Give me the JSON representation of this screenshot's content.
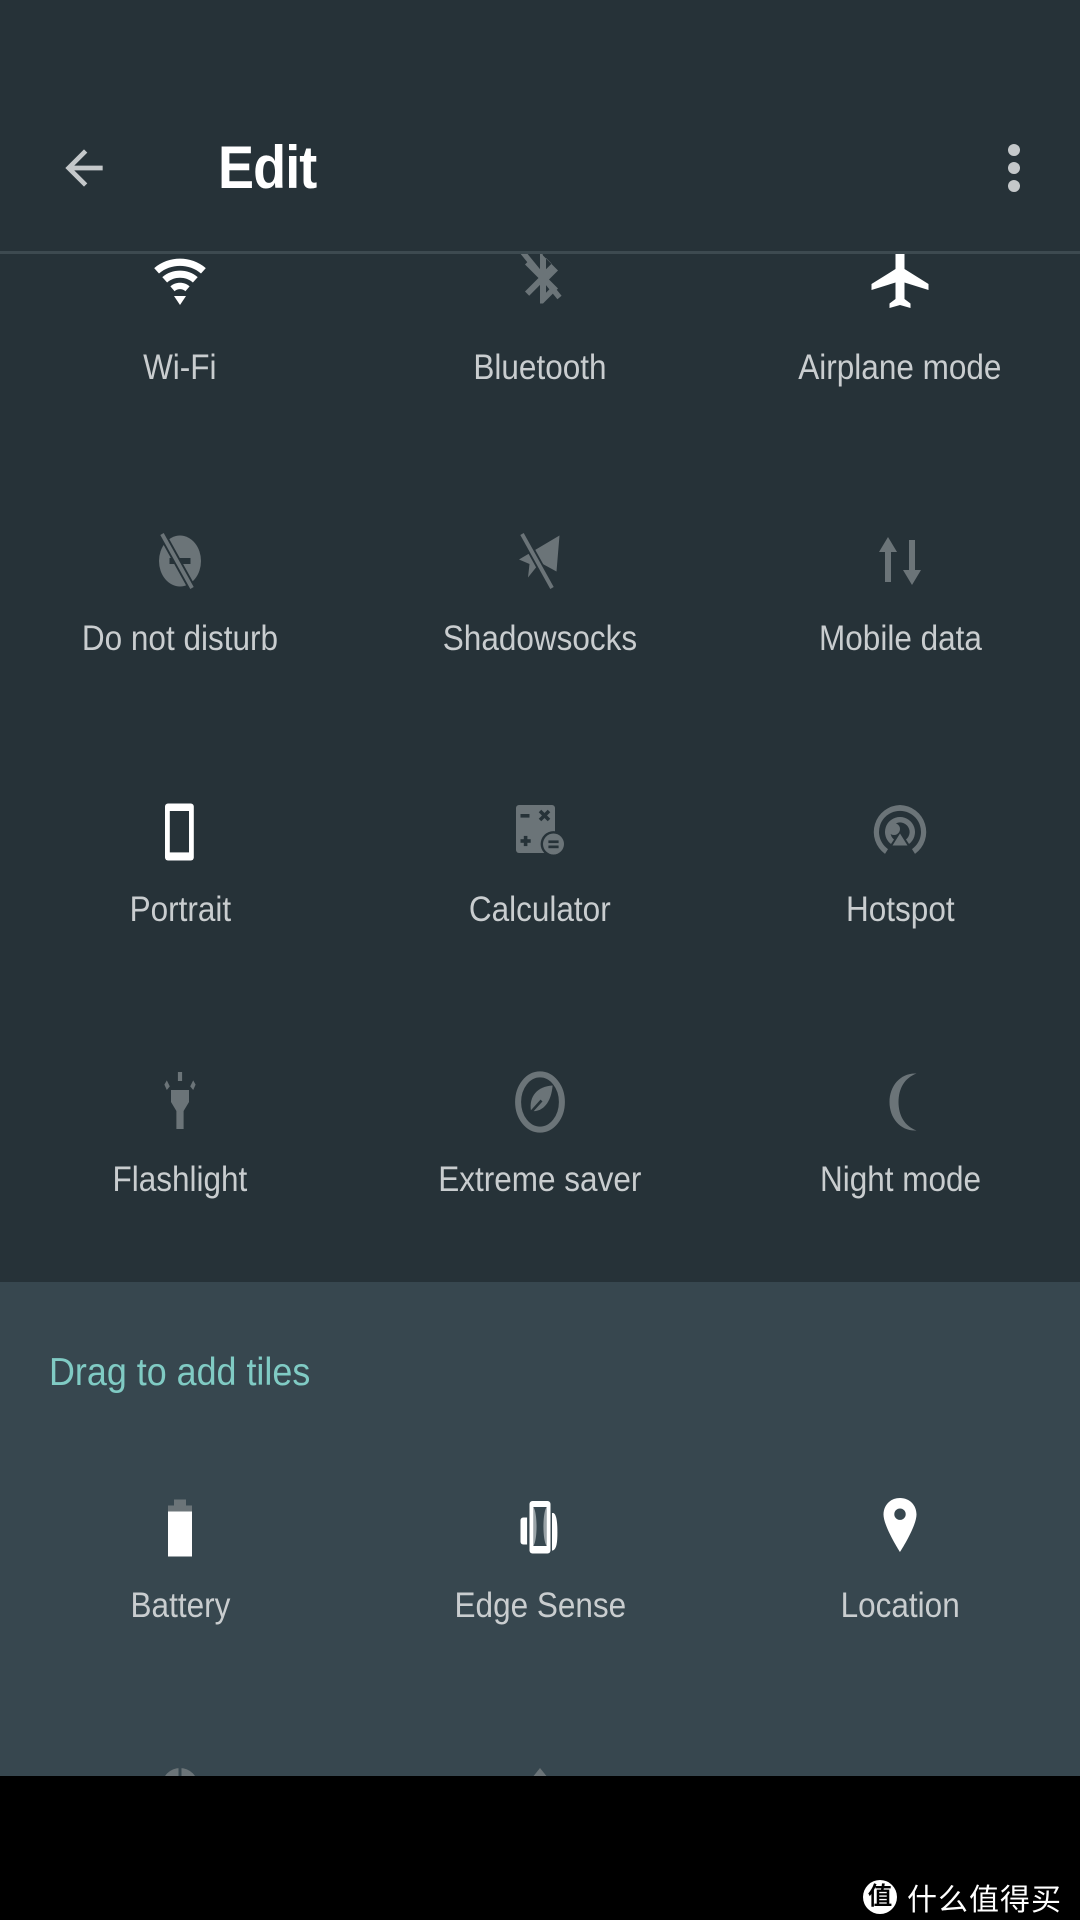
{
  "header": {
    "title": "Edit",
    "back_icon": "arrow-back-icon",
    "overflow_icon": "more-vert-icon"
  },
  "colors": {
    "header_bg": "#263238",
    "tiles_bg": "#263238",
    "drag_bg": "#37474f",
    "accent": "#80cbc4",
    "icon_active": "#ffffff",
    "icon_inactive": "#6b7478",
    "label": "#c9cdcf"
  },
  "active_tiles": [
    {
      "label": "Wi-Fi",
      "icon": "wifi-icon",
      "state": "on"
    },
    {
      "label": "Bluetooth",
      "icon": "bluetooth-disabled-icon",
      "state": "off"
    },
    {
      "label": "Airplane mode",
      "icon": "airplane-icon",
      "state": "on"
    },
    {
      "label": "Do not disturb",
      "icon": "do-not-disturb-off-icon",
      "state": "off"
    },
    {
      "label": "Shadowsocks",
      "icon": "paper-plane-off-icon",
      "state": "off"
    },
    {
      "label": "Mobile data",
      "icon": "mobile-data-icon",
      "state": "off"
    },
    {
      "label": "Portrait",
      "icon": "portrait-phone-icon",
      "state": "on"
    },
    {
      "label": "Calculator",
      "icon": "calculator-icon",
      "state": "off"
    },
    {
      "label": "Hotspot",
      "icon": "hotspot-icon",
      "state": "off"
    },
    {
      "label": "Flashlight",
      "icon": "flashlight-icon",
      "state": "off"
    },
    {
      "label": "Extreme saver",
      "icon": "leaf-saver-icon",
      "state": "off"
    },
    {
      "label": "Night mode",
      "icon": "moon-icon",
      "state": "off"
    }
  ],
  "drag_section": {
    "title": "Drag to add tiles",
    "tiles": [
      {
        "label": "Battery",
        "icon": "battery-icon",
        "state": "on"
      },
      {
        "label": "Edge Sense",
        "icon": "edge-sense-icon",
        "state": "on"
      },
      {
        "label": "Location",
        "icon": "location-pin-icon",
        "state": "on"
      }
    ]
  },
  "watermark": {
    "badge": "值",
    "text": "什么值得买"
  }
}
